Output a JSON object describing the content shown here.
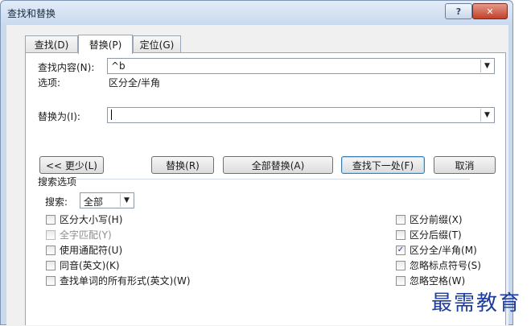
{
  "window": {
    "title": "查找和替换",
    "help_label": "?",
    "close_label": "✕"
  },
  "tabs": [
    {
      "label": "查找(D)"
    },
    {
      "label": "替换(P)"
    },
    {
      "label": "定位(G)"
    }
  ],
  "find": {
    "label": "查找内容(N):",
    "value": "^b",
    "options_label": "选项:",
    "options_value": "区分全/半角"
  },
  "replace": {
    "label": "替换为(I):",
    "value": ""
  },
  "buttons": {
    "less": "<< 更少(L)",
    "replace": "替换(R)",
    "replace_all": "全部替换(A)",
    "find_next": "查找下一处(F)",
    "cancel": "取消"
  },
  "search_options": {
    "title": "搜索选项",
    "direction_label": "搜索:",
    "direction_value": "全部"
  },
  "checkboxes_left": [
    {
      "label": "区分大小写(H)",
      "checked": false,
      "disabled": false
    },
    {
      "label": "全字匹配(Y)",
      "checked": false,
      "disabled": true
    },
    {
      "label": "使用通配符(U)",
      "checked": false,
      "disabled": false
    },
    {
      "label": "同音(英文)(K)",
      "checked": false,
      "disabled": false
    },
    {
      "label": "查找单词的所有形式(英文)(W)",
      "checked": false,
      "disabled": false
    }
  ],
  "checkboxes_right": [
    {
      "label": "区分前缀(X)",
      "checked": false,
      "disabled": false
    },
    {
      "label": "区分后缀(T)",
      "checked": false,
      "disabled": false
    },
    {
      "label": "区分全/半角(M)",
      "checked": true,
      "disabled": false
    },
    {
      "label": "忽略标点符号(S)",
      "checked": false,
      "disabled": false
    },
    {
      "label": "忽略空格(W)",
      "checked": false,
      "disabled": false
    }
  ],
  "watermark": "最需教育",
  "icons": {
    "dropdown": "chevron-down-icon",
    "check": "checkmark-icon"
  }
}
